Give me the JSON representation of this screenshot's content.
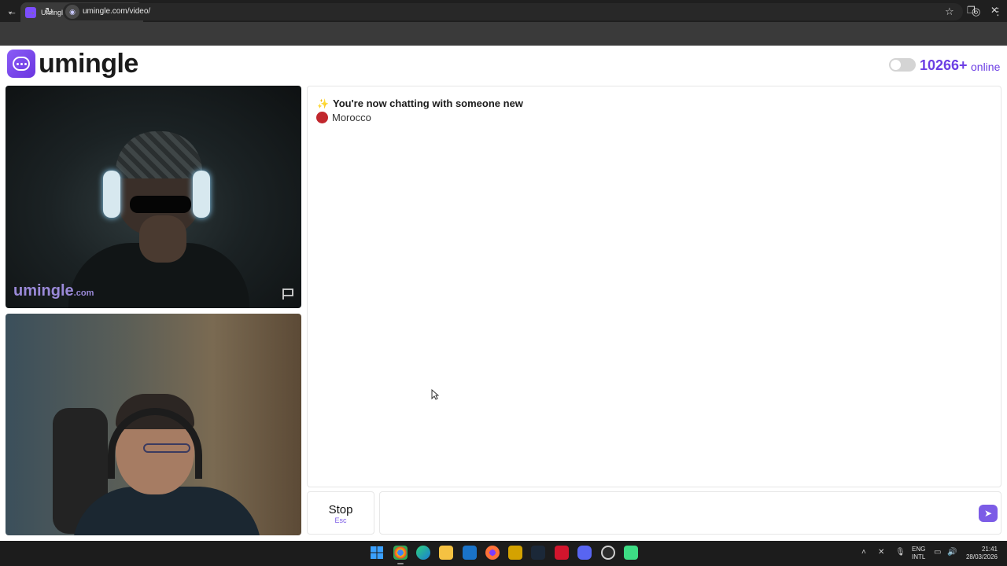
{
  "browser": {
    "tab_title": "Umingle: Video Chat with S",
    "url": "umingle.com/video/",
    "new_tab": "+",
    "close_tab": "✕"
  },
  "header": {
    "logo_text": "umingle",
    "online_count": "10266+",
    "online_label": "online"
  },
  "video": {
    "watermark_main": "umingle",
    "watermark_suffix": ".com"
  },
  "chat": {
    "system_message": "You're now chatting with someone new",
    "country": "Morocco",
    "message_value": ""
  },
  "controls": {
    "stop_label": "Stop",
    "stop_key": "Esc"
  },
  "taskbar": {
    "lang_line1": "ENG",
    "lang_line2": "INTL",
    "time": "21:41",
    "date": "28/03/2026"
  },
  "colors": {
    "brand": "#6d3fe4",
    "country_flag": "#c1272d"
  }
}
